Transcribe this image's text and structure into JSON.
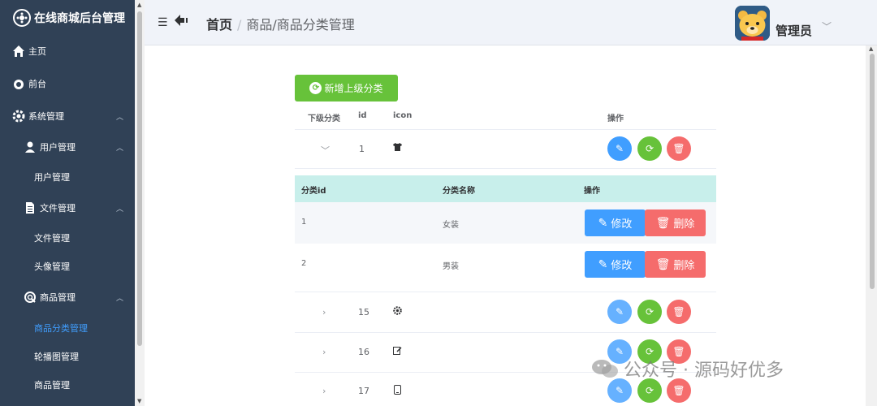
{
  "sidebar": {
    "title": "在线商城后台管理",
    "items": [
      {
        "label": "主页",
        "icon": "home-icon"
      },
      {
        "label": "前台",
        "icon": "drop-icon"
      },
      {
        "label": "系统管理",
        "icon": "gear-icon"
      },
      {
        "label": "用户管理",
        "icon": "user-icon"
      },
      {
        "label": "用户管理"
      },
      {
        "label": "文件管理",
        "icon": "file-icon"
      },
      {
        "label": "文件管理"
      },
      {
        "label": "头像管理"
      },
      {
        "label": "商品管理",
        "icon": "search-icon"
      },
      {
        "label": "商品分类管理"
      },
      {
        "label": "轮播图管理"
      },
      {
        "label": "商品管理"
      }
    ]
  },
  "header": {
    "home": "首页",
    "separator": "/",
    "current": "商品/商品分类管理",
    "admin_name": "管理员"
  },
  "toolbar": {
    "add_label": "新增上级分类"
  },
  "table": {
    "headers": [
      "下级分类",
      "id",
      "icon",
      "操作"
    ],
    "rows": [
      {
        "id": "1",
        "expanded": true
      },
      {
        "id": "15"
      },
      {
        "id": "16"
      },
      {
        "id": "17"
      }
    ]
  },
  "sub_table": {
    "headers": [
      "分类id",
      "分类名称",
      "操作"
    ],
    "rows": [
      {
        "id": "1",
        "name": "女装"
      },
      {
        "id": "2",
        "name": "男装"
      }
    ],
    "edit_label": "修改",
    "delete_label": "删除"
  },
  "watermark": {
    "text": "公众号 · 源码好优多"
  },
  "colors": {
    "sidebar_bg": "#304156",
    "primary": "#409eff",
    "success": "#67c23a",
    "danger": "#f56c6c",
    "sub_header_bg": "#c8efeb"
  }
}
